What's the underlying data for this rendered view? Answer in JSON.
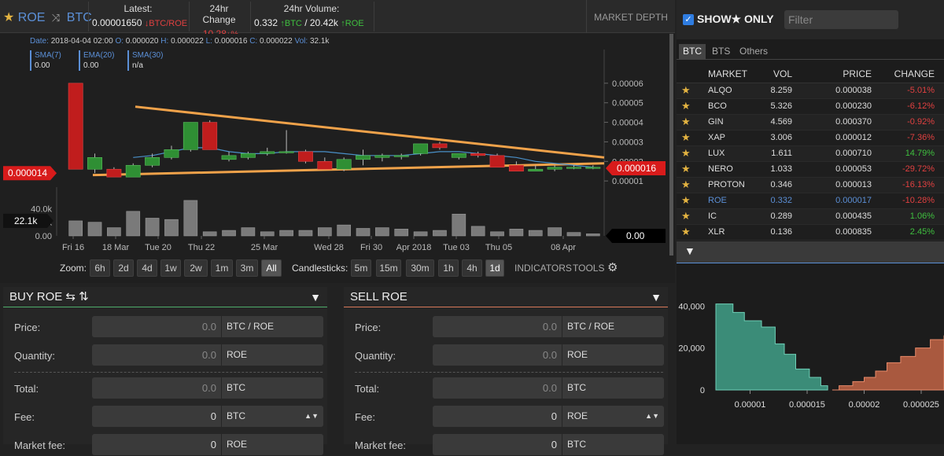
{
  "header": {
    "star": "★",
    "base": "ROE",
    "quote": "BTC",
    "latest_label": "Latest:",
    "latest_value": "0.00001650",
    "latest_unit": "↓BTC/ROE",
    "change_label": "24hr Change",
    "change_value": "-10.28",
    "change_unit": "↓%",
    "volume_label": "24hr Volume:",
    "volume_btc": "0.332",
    "volume_btc_unit": "↑BTC",
    "volume_roe": "/ 20.42k",
    "volume_roe_unit": "↑ROE",
    "market_depth": "MARKET DEPTH"
  },
  "ohlc": {
    "date_k": "Date:",
    "date": "2018-04-04 02:00",
    "o_k": "O:",
    "o": "0.000020",
    "h_k": "H:",
    "h": "0.000022",
    "l_k": "L:",
    "l": "0.000016",
    "c_k": "C:",
    "c": "0.000022",
    "v_k": "Vol:",
    "v": "32.1k"
  },
  "indicators": [
    {
      "name": "SMA(7)",
      "value": "0.00"
    },
    {
      "name": "EMA(20)",
      "value": "0.00"
    },
    {
      "name": "SMA(30)",
      "value": "n/a"
    }
  ],
  "chart_data": {
    "type": "candlestick",
    "x_ticks": [
      "Fri 16",
      "18 Mar",
      "Tue 20",
      "Thu 22",
      "25 Mar",
      "Wed 28",
      "Fri 30",
      "Apr 2018",
      "Tue 03",
      "Thu 05",
      "08 Apr"
    ],
    "y_ticks": [
      "0.00006",
      "0.00005",
      "0.00004",
      "0.00003",
      "0.00002",
      "0.00001"
    ],
    "y_range": [
      0,
      7e-05
    ],
    "vol_ticks": [
      "40.0k",
      "20.0k",
      "0.00"
    ],
    "vol_range": [
      0,
      60000
    ],
    "left_price_label": "0.000014",
    "left_vol_label": "22.1k",
    "right_price_label": "0.000016",
    "right_vol_label": "0.00",
    "candles": [
      {
        "o": 6e-05,
        "h": 6e-05,
        "l": 1.6e-05,
        "c": 1.6e-05,
        "v": 22000
      },
      {
        "o": 1.6e-05,
        "h": 2.4e-05,
        "l": 1.4e-05,
        "c": 2.2e-05,
        "v": 20000
      },
      {
        "o": 1.6e-05,
        "h": 1.7e-05,
        "l": 1.2e-05,
        "c": 1.2e-05,
        "v": 12000
      },
      {
        "o": 1.2e-05,
        "h": 1.9e-05,
        "l": 1.2e-05,
        "c": 1.8e-05,
        "v": 36000
      },
      {
        "o": 1.8e-05,
        "h": 2.4e-05,
        "l": 1.7e-05,
        "c": 2.2e-05,
        "v": 26000
      },
      {
        "o": 2.2e-05,
        "h": 2.8e-05,
        "l": 2.1e-05,
        "c": 2.6e-05,
        "v": 24000
      },
      {
        "o": 2.6e-05,
        "h": 4e-05,
        "l": 2.5e-05,
        "c": 4e-05,
        "v": 52000
      },
      {
        "o": 4e-05,
        "h": 4.1e-05,
        "l": 2.6e-05,
        "c": 2.6e-05,
        "v": 6000
      },
      {
        "o": 2.1e-05,
        "h": 2.5e-05,
        "l": 2e-05,
        "c": 2.3e-05,
        "v": 8000
      },
      {
        "o": 2.2e-05,
        "h": 2.5e-05,
        "l": 2.1e-05,
        "c": 2.4e-05,
        "v": 12000
      },
      {
        "o": 2.4e-05,
        "h": 2.7e-05,
        "l": 2.3e-05,
        "c": 2.5e-05,
        "v": 6000
      },
      {
        "o": 2.5e-05,
        "h": 3.6e-05,
        "l": 2.4e-05,
        "c": 2.5e-05,
        "v": 8000
      },
      {
        "o": 2.5e-05,
        "h": 2.6e-05,
        "l": 1.9e-05,
        "c": 2e-05,
        "v": 8000
      },
      {
        "o": 2e-05,
        "h": 2.2e-05,
        "l": 1.6e-05,
        "c": 1.6e-05,
        "v": 12000
      },
      {
        "o": 1.6e-05,
        "h": 2.2e-05,
        "l": 1.5e-05,
        "c": 2.1e-05,
        "v": 16000
      },
      {
        "o": 2.1e-05,
        "h": 2.6e-05,
        "l": 1.8e-05,
        "c": 2.3e-05,
        "v": 11000
      },
      {
        "o": 2.2e-05,
        "h": 2.4e-05,
        "l": 2e-05,
        "c": 2.3e-05,
        "v": 12000
      },
      {
        "o": 2.3e-05,
        "h": 2.4e-05,
        "l": 2.1e-05,
        "c": 2.3e-05,
        "v": 10000
      },
      {
        "o": 2.4e-05,
        "h": 2.9e-05,
        "l": 2.3e-05,
        "c": 2.9e-05,
        "v": 6000
      },
      {
        "o": 2.9e-05,
        "h": 3e-05,
        "l": 2.6e-05,
        "c": 2.7e-05,
        "v": 8000
      },
      {
        "o": 2.2e-05,
        "h": 2.4e-05,
        "l": 2.1e-05,
        "c": 2.4e-05,
        "v": 32000
      },
      {
        "o": 2.4e-05,
        "h": 2.5e-05,
        "l": 2.2e-05,
        "c": 2.3e-05,
        "v": 14000
      },
      {
        "o": 2.3e-05,
        "h": 2.4e-05,
        "l": 1.7e-05,
        "c": 1.7e-05,
        "v": 6000
      },
      {
        "o": 1.8e-05,
        "h": 2e-05,
        "l": 1.5e-05,
        "c": 1.5e-05,
        "v": 10000
      },
      {
        "o": 1.5e-05,
        "h": 1.8e-05,
        "l": 1.5e-05,
        "c": 1.6e-05,
        "v": 8000
      },
      {
        "o": 1.6e-05,
        "h": 1.8e-05,
        "l": 1.5e-05,
        "c": 1.7e-05,
        "v": 12000
      },
      {
        "o": 1.7e-05,
        "h": 1.8e-05,
        "l": 1.6e-05,
        "c": 1.7e-05,
        "v": 5000
      },
      {
        "o": 1.7e-05,
        "h": 1.8e-05,
        "l": 1.6e-05,
        "c": 1.7e-05,
        "v": 3000
      }
    ],
    "ma_line": [
      2.8e-05,
      2.6e-05,
      2.2e-05,
      2.2e-05,
      2.3e-05,
      2.5e-05,
      2.7e-05,
      2.7e-05,
      2.5e-05,
      2.4e-05,
      2.4e-05,
      2.5e-05,
      2.5e-05,
      2.5e-05,
      2.4e-05,
      2.3e-05,
      2.3e-05,
      2.3e-05,
      2.4e-05,
      2.5e-05,
      2.5e-05,
      2.4e-05,
      2.3e-05,
      2.2e-05,
      2e-05,
      1.9e-05,
      1.8e-05,
      1.7e-05
    ],
    "trend_upper": [
      4.8e-05,
      2.2e-05
    ],
    "trend_lower": [
      1.3e-05,
      1.9e-05
    ]
  },
  "zoom": {
    "label": "Zoom:",
    "options": [
      "6h",
      "2d",
      "4d",
      "1w",
      "2w",
      "1m",
      "3m",
      "All"
    ],
    "selected": "All"
  },
  "candlesticks": {
    "label": "Candlesticks:",
    "options": [
      "5m",
      "15m",
      "30m",
      "1h",
      "4h",
      "1d"
    ],
    "selected": "1d"
  },
  "tools": {
    "indicators": "INDICATORS",
    "tools": "TOOLS"
  },
  "buy": {
    "title": "BUY ROE ⇆ ⇅",
    "price_label": "Price:",
    "price_value": "0.0",
    "price_unit": "BTC / ROE",
    "qty_label": "Quantity:",
    "qty_value": "0.0",
    "qty_unit": "ROE",
    "total_label": "Total:",
    "total_value": "0.0",
    "total_unit": "BTC",
    "fee_label": "Fee:",
    "fee_value": "0",
    "fee_unit": "BTC",
    "market_fee_label": "Market fee:",
    "market_fee_value": "0",
    "market_fee_unit": "ROE"
  },
  "sell": {
    "title": "SELL ROE",
    "price_label": "Price:",
    "price_value": "0.0",
    "price_unit": "BTC / ROE",
    "qty_label": "Quantity:",
    "qty_value": "0.0",
    "qty_unit": "ROE",
    "total_label": "Total:",
    "total_value": "0.0",
    "total_unit": "BTC",
    "fee_label": "Fee:",
    "fee_value": "0",
    "fee_unit": "ROE",
    "market_fee_label": "Market fee:",
    "market_fee_value": "0",
    "market_fee_unit": "BTC"
  },
  "sidebar": {
    "show_label": "SHOW★ ONLY",
    "filter_placeholder": "Filter",
    "tabs": [
      "BTC",
      "BTS",
      "Others"
    ],
    "columns": {
      "market": "MARKET",
      "vol": "VOL",
      "price": "PRICE",
      "change": "CHANGE"
    },
    "markets": [
      {
        "market": "ALQO",
        "vol": "8.259",
        "price": "0.000038",
        "change": "-5.01%"
      },
      {
        "market": "BCO",
        "vol": "5.326",
        "price": "0.000230",
        "change": "-6.12%"
      },
      {
        "market": "GIN",
        "vol": "4.569",
        "price": "0.000370",
        "change": "-0.92%"
      },
      {
        "market": "XAP",
        "vol": "3.006",
        "price": "0.000012",
        "change": "-7.36%"
      },
      {
        "market": "LUX",
        "vol": "1.611",
        "price": "0.000710",
        "change": "14.79%"
      },
      {
        "market": "NERO",
        "vol": "1.033",
        "price": "0.000053",
        "change": "-29.72%"
      },
      {
        "market": "PROTON",
        "vol": "0.346",
        "price": "0.000013",
        "change": "-16.13%"
      },
      {
        "market": "ROE",
        "vol": "0.332",
        "price": "0.000017",
        "change": "-10.28%"
      },
      {
        "market": "IC",
        "vol": "0.289",
        "price": "0.000435",
        "change": "1.06%"
      },
      {
        "market": "XLR",
        "vol": "0.136",
        "price": "0.000835",
        "change": "2.45%"
      }
    ]
  },
  "depth": {
    "y_ticks": [
      "40,000",
      "20,000",
      "0"
    ],
    "x_ticks": [
      "0.00001",
      "0.000015",
      "0.00002",
      "0.000025"
    ],
    "bids": [
      [
        7e-06,
        41000
      ],
      [
        8.5e-06,
        37000
      ],
      [
        9.5e-06,
        33000
      ],
      [
        1.1e-05,
        30000
      ],
      [
        1.22e-05,
        22000
      ],
      [
        1.3e-05,
        17000
      ],
      [
        1.4e-05,
        10000
      ],
      [
        1.52e-05,
        6000
      ],
      [
        1.62e-05,
        2000
      ],
      [
        1.68e-05,
        0
      ]
    ],
    "asks": [
      [
        1.72e-05,
        0
      ],
      [
        1.78e-05,
        2000
      ],
      [
        1.9e-05,
        4000
      ],
      [
        2e-05,
        6000
      ],
      [
        2.1e-05,
        9000
      ],
      [
        2.2e-05,
        13000
      ],
      [
        2.32e-05,
        16000
      ],
      [
        2.45e-05,
        20000
      ],
      [
        2.58e-05,
        24000
      ],
      [
        2.7e-05,
        26000
      ]
    ],
    "x_range": [
      7e-06,
      2.7e-05
    ],
    "y_range": [
      0,
      45000
    ]
  }
}
